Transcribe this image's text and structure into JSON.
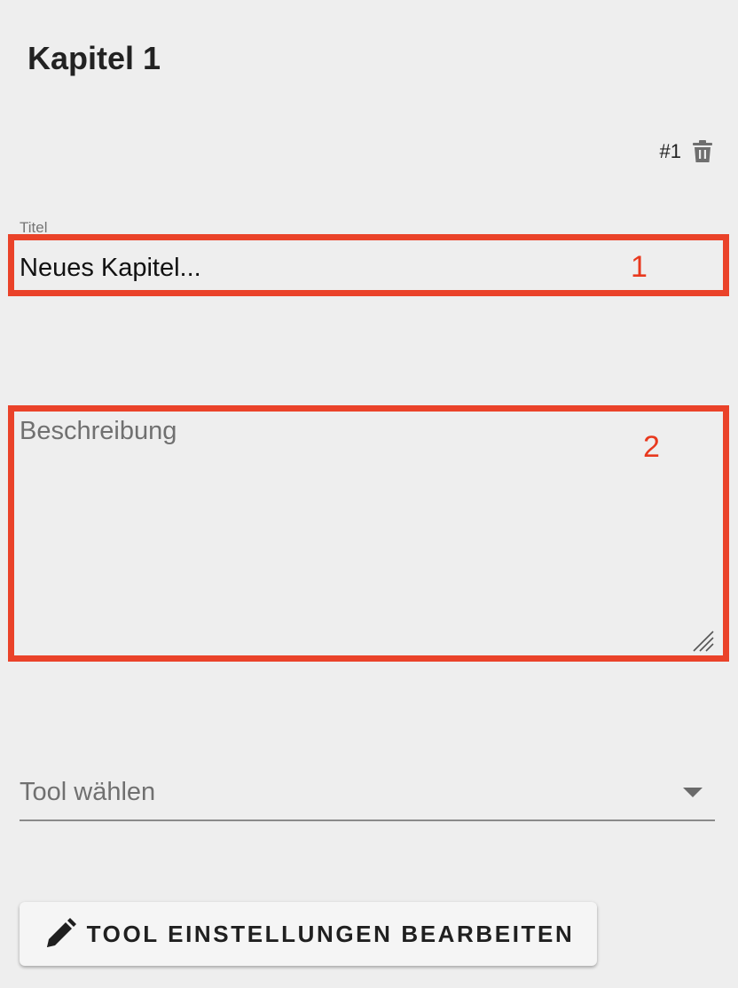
{
  "header": {
    "title": "Kapitel 1",
    "index": "#1"
  },
  "fields": {
    "title_label": "Titel",
    "title_value": "Neues Kapitel...",
    "description_placeholder": "Beschreibung",
    "description_value": ""
  },
  "annotations": {
    "box1": "1",
    "box2": "2",
    "color": "#ea4229"
  },
  "tool_select": {
    "label": "Tool wählen"
  },
  "tool_button": {
    "label": "TOOL EINSTELLUNGEN BEARBEITEN",
    "icon": "pencil-icon"
  },
  "icons": {
    "delete": "trash-icon",
    "dropdown": "chevron-down-icon"
  }
}
